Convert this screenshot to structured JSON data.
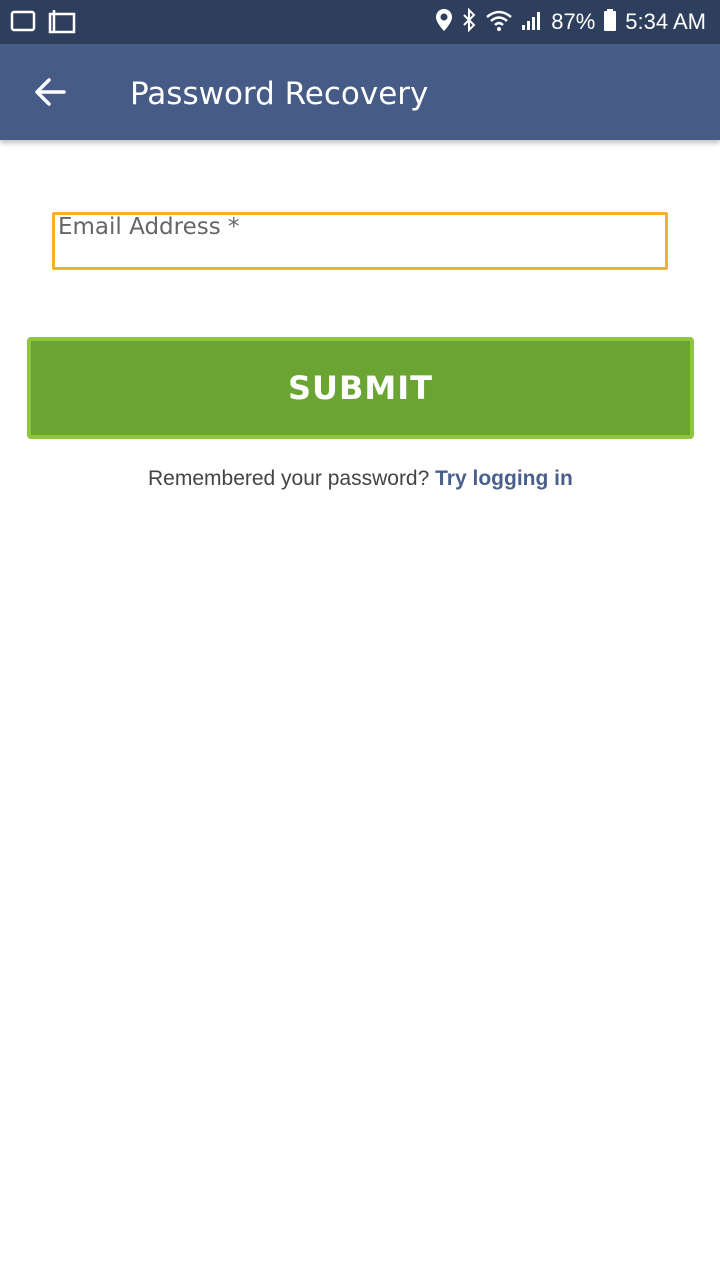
{
  "status_bar": {
    "battery": "87%",
    "time": "5:34 AM",
    "icons": [
      "notification-icon",
      "screenshot-icon",
      "location-icon",
      "bluetooth-icon",
      "wifi-icon",
      "signal-icon",
      "battery-icon"
    ]
  },
  "app_bar": {
    "title": "Password Recovery",
    "back_icon": "arrow-left-icon"
  },
  "form": {
    "email_label": "Email Address *",
    "email_value": "",
    "submit_label": "SUBMIT",
    "remember_prefix": "Remembered your password?",
    "login_link": "Try logging in"
  },
  "colors": {
    "status_bar": "#2e3f5e",
    "app_bar": "#475b87",
    "submit": "#6aa534",
    "link": "#4a5f8c"
  }
}
